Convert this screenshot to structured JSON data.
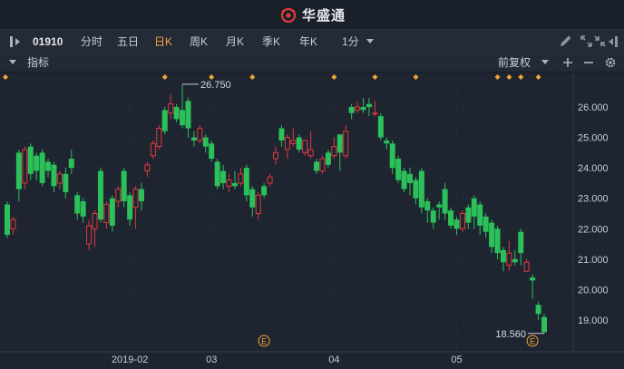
{
  "app": {
    "brand": "华盛通"
  },
  "toolbar": {
    "stock_code": "01910",
    "periods": [
      {
        "label": "分时",
        "active": false
      },
      {
        "label": "五日",
        "active": false
      },
      {
        "label": "日K",
        "active": true
      },
      {
        "label": "周K",
        "active": false
      },
      {
        "label": "月K",
        "active": false
      },
      {
        "label": "季K",
        "active": false
      },
      {
        "label": "年K",
        "active": false
      }
    ],
    "minute_select": "1分"
  },
  "subbar": {
    "indicators_label": "指标",
    "adjust_select": "前复权"
  },
  "colors": {
    "up": "#e0393e",
    "down": "#2bc05a",
    "accent": "#f0a63a",
    "background": "#1e2530",
    "grid": "#2c3440"
  },
  "icons": [
    "layout-toggle-icon",
    "chevron-down-icon",
    "pencil-icon",
    "expand-icon",
    "shrink-icon",
    "collapse-icon",
    "plus-icon",
    "minus-icon",
    "gear-icon",
    "event-marker-icon"
  ],
  "chart_data": {
    "type": "candlestick",
    "ylim": [
      18.3,
      26.8
    ],
    "y_ticks": [
      "26.000",
      "25.000",
      "24.000",
      "23.000",
      "22.000",
      "21.000",
      "20.000",
      "19.000"
    ],
    "x_ticks": [
      "2019-02",
      "03",
      "04",
      "05"
    ],
    "annotations": {
      "high": "26.750",
      "low": "18.560"
    },
    "event_markers": [
      "E",
      "E"
    ],
    "candles": [
      [
        22.8,
        21.8,
        22.9,
        21.7
      ],
      [
        22.0,
        22.3,
        22.4,
        21.8
      ],
      [
        24.5,
        23.3,
        24.6,
        22.9
      ],
      [
        23.5,
        24.6,
        24.7,
        23.3
      ],
      [
        24.7,
        23.8,
        24.8,
        23.6
      ],
      [
        24.4,
        23.9,
        24.5,
        23.6
      ],
      [
        24.5,
        23.5,
        24.6,
        23.4
      ],
      [
        24.2,
        23.9,
        24.3,
        23.7
      ],
      [
        24.1,
        23.4,
        24.2,
        23.2
      ],
      [
        23.5,
        23.8,
        23.9,
        23.3
      ],
      [
        23.8,
        23.2,
        24.0,
        23.0
      ],
      [
        24.3,
        24.0,
        24.6,
        23.8
      ],
      [
        23.1,
        22.5,
        23.2,
        22.3
      ],
      [
        22.9,
        22.4,
        23.0,
        22.2
      ],
      [
        21.5,
        22.1,
        22.3,
        21.3
      ],
      [
        22.0,
        22.5,
        22.6,
        21.4
      ],
      [
        23.9,
        22.3,
        24.0,
        22.2
      ],
      [
        22.2,
        22.8,
        22.9,
        22.0
      ],
      [
        23.0,
        22.1,
        23.1,
        21.9
      ],
      [
        22.9,
        23.3,
        23.4,
        22.7
      ],
      [
        23.9,
        22.9,
        24.0,
        22.7
      ],
      [
        23.1,
        22.3,
        23.2,
        22.1
      ],
      [
        22.7,
        23.3,
        23.4,
        22.0
      ],
      [
        23.3,
        22.9,
        23.5,
        22.6
      ],
      [
        23.9,
        24.1,
        24.2,
        23.7
      ],
      [
        24.4,
        24.8,
        24.9,
        24.3
      ],
      [
        24.7,
        25.3,
        25.4,
        24.6
      ],
      [
        25.9,
        25.2,
        26.0,
        25.1
      ],
      [
        25.8,
        26.1,
        26.4,
        25.6
      ],
      [
        26.0,
        25.6,
        26.1,
        25.5
      ],
      [
        25.9,
        25.4,
        26.75,
        25.3
      ],
      [
        26.2,
        25.3,
        26.3,
        25.0
      ],
      [
        25.0,
        24.9,
        25.2,
        24.7
      ],
      [
        24.9,
        25.3,
        25.4,
        24.8
      ],
      [
        25.0,
        24.7,
        25.1,
        24.5
      ],
      [
        24.8,
        24.3,
        24.9,
        24.2
      ],
      [
        24.2,
        23.4,
        24.3,
        23.3
      ],
      [
        23.9,
        23.5,
        24.1,
        23.3
      ],
      [
        23.4,
        23.6,
        23.8,
        23.2
      ],
      [
        23.5,
        23.4,
        23.9,
        23.3
      ],
      [
        23.5,
        23.8,
        24.0,
        23.4
      ],
      [
        24.0,
        23.1,
        24.1,
        22.9
      ],
      [
        23.3,
        22.7,
        23.4,
        22.4
      ],
      [
        22.5,
        23.1,
        23.2,
        22.3
      ],
      [
        23.4,
        23.1,
        23.5,
        23.0
      ],
      [
        23.5,
        23.7,
        23.8,
        23.4
      ],
      [
        24.3,
        24.5,
        24.7,
        24.1
      ],
      [
        25.3,
        24.9,
        25.4,
        24.7
      ],
      [
        24.6,
        25.0,
        25.1,
        24.3
      ],
      [
        24.8,
        24.9,
        25.3,
        24.7
      ],
      [
        25.0,
        24.6,
        25.1,
        24.5
      ],
      [
        24.5,
        24.9,
        24.8,
        24.4
      ],
      [
        24.4,
        24.6,
        25.2,
        24.3
      ],
      [
        24.2,
        23.9,
        24.3,
        23.8
      ],
      [
        23.9,
        24.3,
        24.4,
        23.8
      ],
      [
        24.5,
        24.1,
        24.6,
        24.0
      ],
      [
        24.4,
        24.7,
        25.0,
        24.3
      ],
      [
        25.1,
        24.5,
        25.1,
        23.9
      ],
      [
        24.4,
        25.2,
        25.4,
        24.3
      ],
      [
        26.0,
        25.8,
        26.1,
        25.6
      ],
      [
        25.9,
        26.0,
        26.2,
        25.8
      ],
      [
        26.0,
        25.9,
        26.3,
        25.8
      ],
      [
        26.1,
        26.0,
        26.3,
        25.7
      ],
      [
        25.8,
        25.8,
        26.2,
        25.7
      ],
      [
        25.7,
        25.0,
        25.8,
        24.9
      ],
      [
        24.9,
        24.8,
        25.0,
        24.6
      ],
      [
        24.8,
        24.0,
        24.9,
        23.8
      ],
      [
        24.3,
        23.6,
        24.4,
        23.5
      ],
      [
        23.9,
        23.3,
        24.0,
        23.2
      ],
      [
        23.8,
        23.5,
        24.0,
        23.1
      ],
      [
        23.6,
        23.0,
        23.7,
        22.8
      ],
      [
        23.9,
        22.7,
        24.0,
        22.5
      ],
      [
        22.9,
        22.6,
        23.0,
        22.2
      ],
      [
        22.6,
        22.2,
        22.7,
        22.0
      ],
      [
        22.8,
        22.7,
        22.9,
        22.3
      ],
      [
        23.3,
        22.5,
        23.5,
        22.3
      ],
      [
        22.6,
        22.1,
        22.7,
        22.0
      ],
      [
        22.3,
        22.0,
        22.4,
        21.8
      ],
      [
        22.0,
        22.5,
        22.6,
        21.9
      ],
      [
        22.7,
        22.2,
        22.8,
        22.0
      ],
      [
        23.0,
        22.4,
        23.1,
        22.0
      ],
      [
        22.8,
        22.1,
        22.9,
        21.8
      ],
      [
        22.4,
        21.9,
        22.5,
        21.7
      ],
      [
        22.2,
        21.4,
        22.3,
        21.2
      ],
      [
        22.0,
        21.2,
        22.1,
        21.0
      ],
      [
        21.3,
        20.9,
        21.4,
        20.6
      ],
      [
        20.8,
        21.2,
        21.6,
        20.6
      ],
      [
        21.0,
        20.9,
        21.3,
        20.8
      ],
      [
        21.9,
        21.2,
        22.0,
        20.8
      ],
      [
        20.6,
        20.9,
        21.0,
        20.6
      ],
      [
        20.4,
        20.3,
        20.5,
        19.7
      ],
      [
        19.5,
        19.2,
        19.6,
        19.0
      ],
      [
        19.1,
        18.6,
        19.2,
        18.56
      ]
    ]
  }
}
